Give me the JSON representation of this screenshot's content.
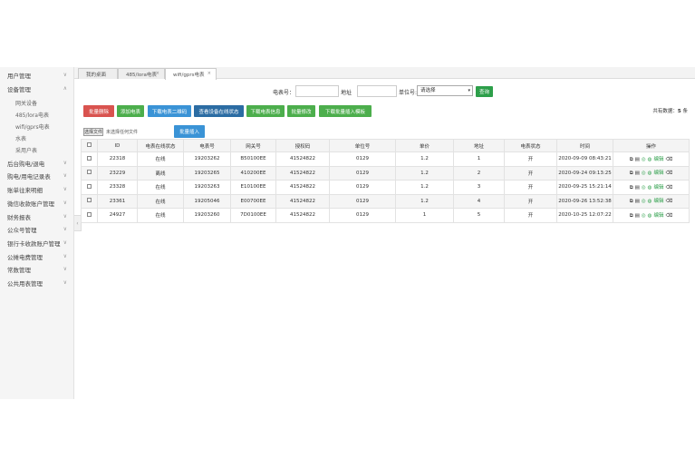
{
  "sidebar": {
    "items": [
      {
        "label": "用户管理",
        "expanded": false
      },
      {
        "label": "设备管理",
        "expanded": true
      },
      {
        "label": "后台购电/退电",
        "expanded": false
      },
      {
        "label": "购电/用电记录表",
        "expanded": false
      },
      {
        "label": "账单往来明细",
        "expanded": false
      },
      {
        "label": "微信收款账户管理",
        "expanded": false
      },
      {
        "label": "财务报表",
        "expanded": false
      },
      {
        "label": "公众号管理",
        "expanded": false
      },
      {
        "label": "银行卡收款账户管理",
        "expanded": false
      },
      {
        "label": "公摊电费管理",
        "expanded": false
      },
      {
        "label": "常数管理",
        "expanded": false
      },
      {
        "label": "公共用表管理",
        "expanded": false
      }
    ],
    "device_sub_items": [
      "网关设备",
      "485/lora电表",
      "wifi/gprs电表",
      "水表",
      "采用户表"
    ]
  },
  "tabs": [
    {
      "label": "我的桌面",
      "closable": false
    },
    {
      "label": "485/lora电表",
      "closable": true
    },
    {
      "label": "wifi/gprs电表",
      "closable": true
    }
  ],
  "search": {
    "meter_no_label": "电表号：",
    "meter_no_value": "",
    "address_label": "地址",
    "address_value": "",
    "unit_label": "单位号:",
    "unit_select": "请选择",
    "query_label": "查询"
  },
  "toolbar": {
    "batch_delete": "批量删除",
    "add_meter": "添加电表",
    "download_qr": "下载电表二维码",
    "check_online": "查看设备在线状态",
    "download_info": "下载电表信息",
    "batch_modify": "批量修改",
    "download_import_template": "下载批量插入模板"
  },
  "total": {
    "label": "共有数据：",
    "count": "5",
    "unit": "条"
  },
  "upload": {
    "choose_file": "选择文件",
    "no_file": "未选择任何文件",
    "batch_insert": "批量插入"
  },
  "table": {
    "headers": [
      "ID",
      "电表在线状态",
      "电表号",
      "网关号",
      "授权码",
      "单位号",
      "单价",
      "地址",
      "电表状态",
      "时间",
      "操作"
    ],
    "rows": [
      {
        "id": "22318",
        "online": "在线",
        "meter_no": "19203262",
        "gateway": "B50100EE",
        "auth": "41524822",
        "unit": "0129",
        "price": "1.2",
        "addr": "1",
        "status": "开",
        "time": "2020-09-09 08:43:21"
      },
      {
        "id": "23229",
        "online": "离线",
        "meter_no": "19203265",
        "gateway": "410200EE",
        "auth": "41524822",
        "unit": "0129",
        "price": "1.2",
        "addr": "2",
        "status": "开",
        "time": "2020-09-24 09:13:25"
      },
      {
        "id": "23328",
        "online": "在线",
        "meter_no": "19203263",
        "gateway": "E10100EE",
        "auth": "41524822",
        "unit": "0129",
        "price": "1.2",
        "addr": "3",
        "status": "开",
        "time": "2020-09-25 15:21:14"
      },
      {
        "id": "23361",
        "online": "在线",
        "meter_no": "19205046",
        "gateway": "E00700EE",
        "auth": "41524822",
        "unit": "0129",
        "price": "1.2",
        "addr": "4",
        "status": "开",
        "time": "2020-09-26 13:52:38"
      },
      {
        "id": "24927",
        "online": "在线",
        "meter_no": "19203260",
        "gateway": "7D0100EE",
        "auth": "41524822",
        "unit": "0129",
        "price": "1",
        "addr": "5",
        "status": "开",
        "time": "2020-10-25 12:07:22"
      }
    ],
    "op_edit": "编辑"
  }
}
